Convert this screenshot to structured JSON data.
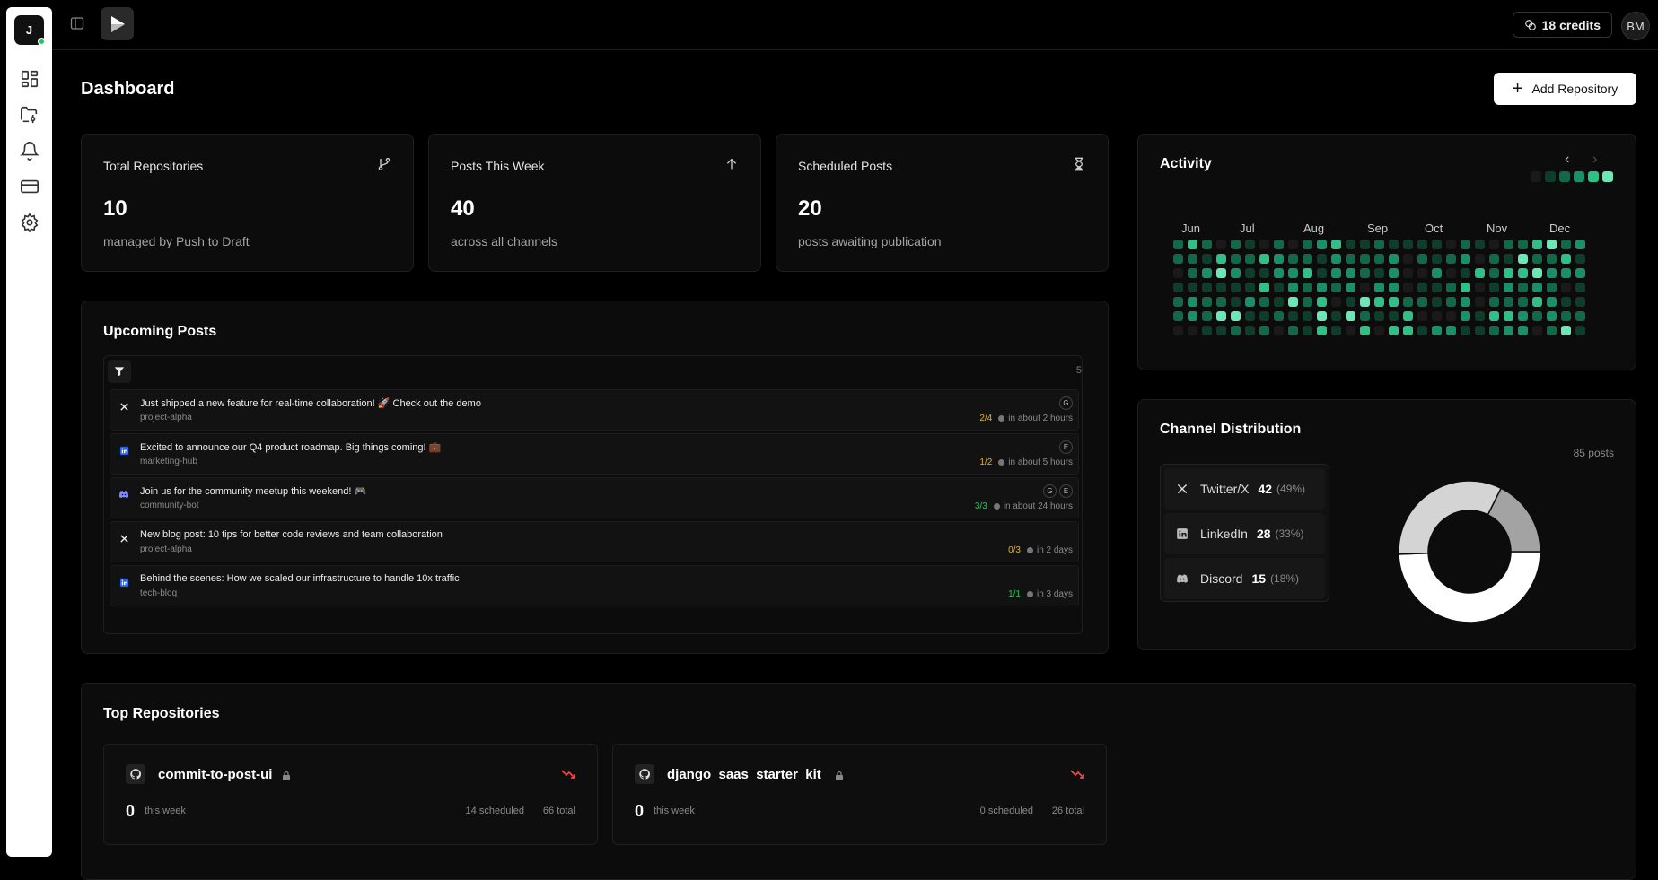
{
  "sidebar": {
    "logo_letter": "J",
    "items": [
      {
        "icon": "dashboard-icon"
      },
      {
        "icon": "folder-git-icon"
      },
      {
        "icon": "bell-icon"
      },
      {
        "icon": "credit-card-icon"
      },
      {
        "icon": "gear-icon"
      }
    ]
  },
  "topbar": {
    "credits": "18 credits",
    "avatar": "BM"
  },
  "page": {
    "title": "Dashboard",
    "add_button": "Add Repository"
  },
  "stats": [
    {
      "label": "Total Repositories",
      "value": "10",
      "sub": "managed by Push to Draft",
      "icon": "git-branch-icon"
    },
    {
      "label": "Posts This Week",
      "value": "40",
      "sub": "across all channels",
      "icon": "arrow-up-icon"
    },
    {
      "label": "Scheduled Posts",
      "value": "20",
      "sub": "posts awaiting publication",
      "icon": "hourglass-icon"
    }
  ],
  "upcoming": {
    "title": "Upcoming Posts",
    "count": "5",
    "posts": [
      {
        "channel": "x",
        "text": "Just shipped a new feature for real-time collaboration! 🚀 Check out the demo",
        "repo": "project-alpha",
        "badges": [
          "G"
        ],
        "ratio": "2/4",
        "ratio_color": "#eab308",
        "time": "in about 2 hours"
      },
      {
        "channel": "linkedin",
        "text": "Excited to announce our Q4 product roadmap. Big things coming! 💼",
        "repo": "marketing-hub",
        "badges": [
          "E"
        ],
        "ratio": "1/2",
        "ratio_color": "#eab308",
        "time": "in about 5 hours"
      },
      {
        "channel": "discord",
        "text": "Join us for the community meetup this weekend! 🎮",
        "repo": "community-bot",
        "badges": [
          "G",
          "E"
        ],
        "ratio": "3/3",
        "ratio_color": "#22c55e",
        "time": "in about 24 hours"
      },
      {
        "channel": "x",
        "text": "New blog post: 10 tips for better code reviews and team collaboration",
        "repo": "project-alpha",
        "badges": [],
        "ratio": "0/3",
        "ratio_color": "#eab308",
        "time": "in 2 days"
      },
      {
        "channel": "linkedin",
        "text": "Behind the scenes: How we scaled our infrastructure to handle 10x traffic",
        "repo": "tech-blog",
        "badges": [],
        "ratio": "1/1",
        "ratio_color": "#22c55e",
        "time": "in 3 days"
      }
    ]
  },
  "activity": {
    "title": "Activity",
    "months": [
      "Jun",
      "Jul",
      "Aug",
      "Sep",
      "Oct",
      "Nov",
      "Dec"
    ],
    "legend_colors": [
      "#1a1a1a",
      "#0f3d2c",
      "#11694a",
      "#1a9068",
      "#2fbf87",
      "#6ee7b7"
    ]
  },
  "channels": {
    "title": "Channel Distribution",
    "total": "85 posts",
    "items": [
      {
        "name": "Twitter/X",
        "value": "42",
        "pct": "(49%)",
        "icon": "x-logo-icon"
      },
      {
        "name": "LinkedIn",
        "value": "28",
        "pct": "(33%)",
        "icon": "linkedin-icon"
      },
      {
        "name": "Discord",
        "value": "15",
        "pct": "(18%)",
        "icon": "discord-icon"
      }
    ],
    "chart_data": {
      "type": "pie",
      "categories": [
        "Twitter/X",
        "LinkedIn",
        "Discord"
      ],
      "values": [
        42,
        28,
        15
      ],
      "colors": [
        "#ffffff",
        "#d4d4d4",
        "#a3a3a3"
      ]
    }
  },
  "repos": {
    "title": "Top Repositories",
    "items": [
      {
        "name": "commit-to-post-ui",
        "week_value": "0",
        "week_label": "this week",
        "scheduled": "14 scheduled",
        "total": "66 total"
      },
      {
        "name": "django_saas_starter_kit",
        "week_value": "0",
        "week_label": "this week",
        "scheduled": "0 scheduled",
        "total": "26 total"
      }
    ]
  }
}
